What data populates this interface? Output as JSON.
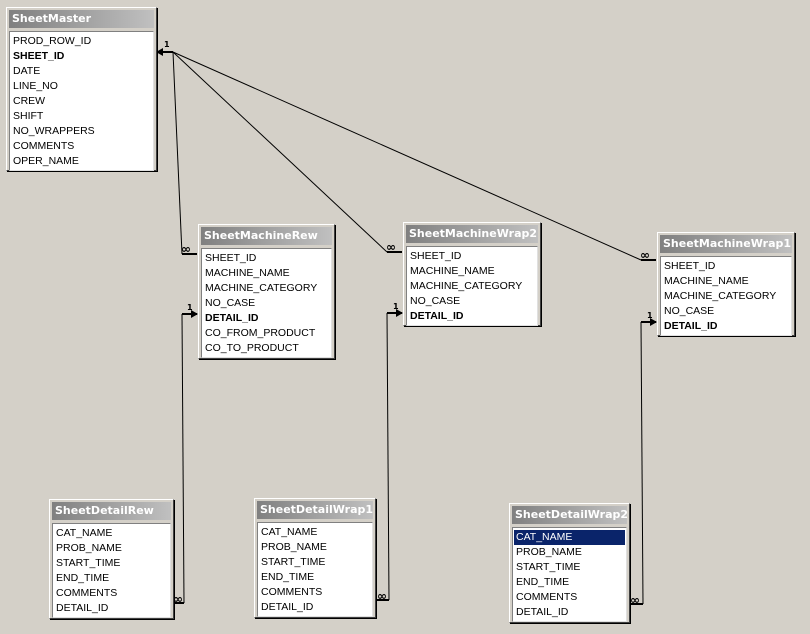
{
  "tables": {
    "sheet_master": {
      "title": "SheetMaster",
      "fields": [
        "PROD_ROW_ID",
        "SHEET_ID",
        "DATE",
        "LINE_NO",
        "CREW",
        "SHIFT",
        "NO_WRAPPERS",
        "COMMENTS",
        "OPER_NAME"
      ]
    },
    "sheet_machine_rew": {
      "title": "SheetMachineRew",
      "fields": [
        "SHEET_ID",
        "MACHINE_NAME",
        "MACHINE_CATEGORY",
        "NO_CASE",
        "DETAIL_ID",
        "CO_FROM_PRODUCT",
        "CO_TO_PRODUCT"
      ]
    },
    "sheet_machine_wrap2": {
      "title": "SheetMachineWrap2",
      "fields": [
        "SHEET_ID",
        "MACHINE_NAME",
        "MACHINE_CATEGORY",
        "NO_CASE",
        "DETAIL_ID"
      ]
    },
    "sheet_machine_wrap1": {
      "title": "SheetMachineWrap1",
      "fields": [
        "SHEET_ID",
        "MACHINE_NAME",
        "MACHINE_CATEGORY",
        "NO_CASE",
        "DETAIL_ID"
      ]
    },
    "sheet_detail_rew": {
      "title": "SheetDetailRew",
      "fields": [
        "CAT_NAME",
        "PROB_NAME",
        "START_TIME",
        "END_TIME",
        "COMMENTS",
        "DETAIL_ID"
      ]
    },
    "sheet_detail_wrap1": {
      "title": "SheetDetailWrap1",
      "fields": [
        "CAT_NAME",
        "PROB_NAME",
        "START_TIME",
        "END_TIME",
        "COMMENTS",
        "DETAIL_ID"
      ]
    },
    "sheet_detail_wrap2": {
      "title": "SheetDetailWrap2",
      "fields": [
        "CAT_NAME",
        "PROB_NAME",
        "START_TIME",
        "END_TIME",
        "COMMENTS",
        "DETAIL_ID"
      ],
      "selected_field": "CAT_NAME"
    }
  },
  "relationships": {
    "one_label": "1",
    "many_label": "∞"
  }
}
